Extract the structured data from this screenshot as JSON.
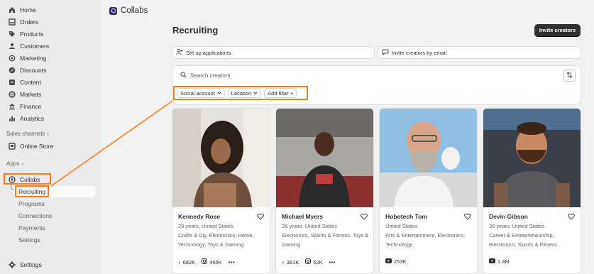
{
  "sidebar": {
    "nav": [
      {
        "label": "Home",
        "icon": "home-icon"
      },
      {
        "label": "Orders",
        "icon": "orders-icon"
      },
      {
        "label": "Products",
        "icon": "tag-icon"
      },
      {
        "label": "Customers",
        "icon": "person-icon"
      },
      {
        "label": "Marketing",
        "icon": "target-icon"
      },
      {
        "label": "Discounts",
        "icon": "discount-icon"
      },
      {
        "label": "Content",
        "icon": "content-icon"
      },
      {
        "label": "Markets",
        "icon": "globe-icon"
      },
      {
        "label": "Finance",
        "icon": "bank-icon"
      },
      {
        "label": "Analytics",
        "icon": "bar-chart-icon"
      }
    ],
    "sales_channels_label": "Sales channels",
    "online_store_label": "Online Store",
    "apps_label": "Apps",
    "collabs_label": "Collabs",
    "sub_items": [
      "Recruiting",
      "Programs",
      "Connections",
      "Payments",
      "Settings"
    ],
    "settings_label": "Settings"
  },
  "header": {
    "app_title": "Collabs"
  },
  "page": {
    "title": "Recruiting",
    "invite_button": "Invite creators",
    "setup_applications": "Set up applications",
    "invite_by_email": "Invite creators by email",
    "search_placeholder": "Search creators",
    "filters": {
      "social": "Social account",
      "location": "Location",
      "add": "Add filter +"
    }
  },
  "creators": [
    {
      "name": "Kennedy Rose",
      "meta": "29 years, United States",
      "categories": "Crafts & Diy, Electronics, Home, Technology, Toys & Gaming",
      "stat1": "682K",
      "stat2": "466K",
      "more": "•••"
    },
    {
      "name": "Michael Myers",
      "meta": "28 years, United States",
      "categories": "Electronics, Sports & Fitness, Toys & Gaming",
      "stat1": "381K",
      "stat2": "52K",
      "more": "•••"
    },
    {
      "name": "Hobotech Tom",
      "meta": "United States",
      "categories": "Arts & Entertainment, Electronics, Technology",
      "stat1": "253K"
    },
    {
      "name": "Devin Gibson",
      "meta": "30 years, United States",
      "categories": "Career & Entrepreneurship, Electronics, Sports & Fitness",
      "stat1": "1.4M"
    }
  ],
  "colors": {
    "accent_highlight": "#ff7a1a",
    "primary_button": "#303030",
    "sidebar_bg": "#ebebeb",
    "page_bg": "#f1f1f1"
  }
}
